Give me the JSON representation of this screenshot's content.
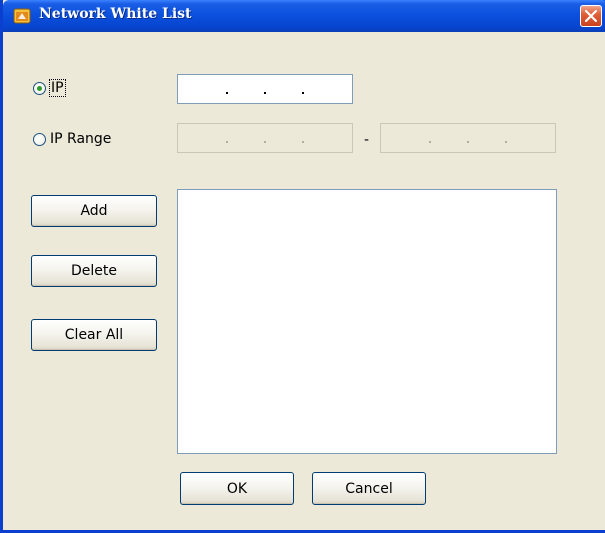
{
  "window": {
    "title": "Network White List"
  },
  "mode": {
    "ip_label": "IP",
    "ip_range_label": "IP Range",
    "selected": "IP",
    "range_separator": "-"
  },
  "ip_fields": {
    "single": ".  .  .",
    "range_start": ".  .  .",
    "range_end": ".  .  ."
  },
  "buttons": {
    "add": "Add",
    "delete": "Delete",
    "clear_all": "Clear All",
    "ok": "OK",
    "cancel": "Cancel"
  },
  "white_list": {
    "items": []
  },
  "colors": {
    "titlebar": "#0a4fdc",
    "window_bg": "#ece9d8",
    "close": "#e0603a",
    "radio_check": "#2e9b2e"
  },
  "icons": {
    "app": "app-icon",
    "close": "close-icon"
  }
}
